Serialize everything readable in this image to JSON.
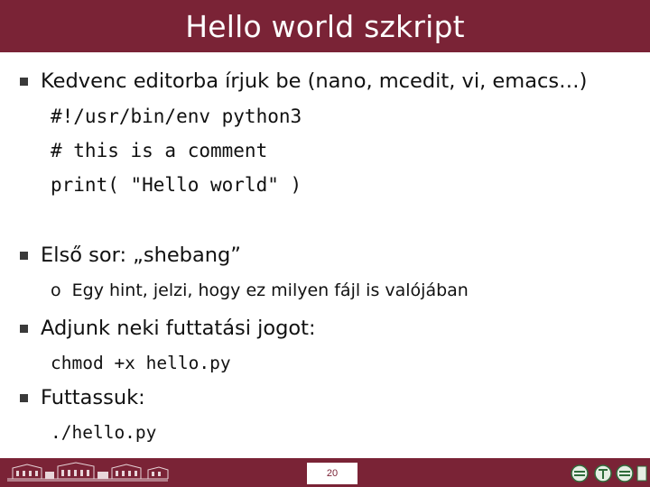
{
  "title": "Hello world szkript",
  "bullets": [
    {
      "text": "Kedvenc editorba írjuk be (nano, mcedit, vi, emacs…)"
    },
    {
      "text": "Első sor: „shebang”"
    },
    {
      "text": "Adjunk neki futtatási jogot:"
    },
    {
      "text": "Futtassuk:"
    }
  ],
  "code_block": [
    "#!/usr/bin/env python3",
    "# this is a comment",
    "print( \"Hello world\" )"
  ],
  "sub_items": [
    {
      "marker": "o",
      "text": "Egy hint, jelzi, hogy ez milyen fájl is valójában"
    }
  ],
  "commands": [
    "chmod +x hello.py",
    "./hello.py"
  ],
  "footer": {
    "page_number": "20"
  },
  "colors": {
    "accent": "#7a2336"
  }
}
